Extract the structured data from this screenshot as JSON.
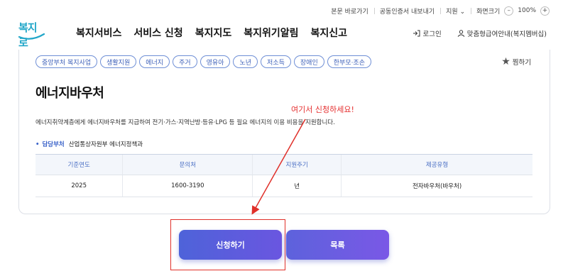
{
  "utility": {
    "skip_link": "본문 바로가기",
    "cert": "공동인증서 내보내기",
    "region": "지원",
    "text_size_label": "화면크기",
    "zoom_minus": "–",
    "zoom_level": "100%",
    "zoom_plus": "+"
  },
  "logo": {
    "text": "복지로"
  },
  "nav": {
    "items": [
      {
        "label": "복지서비스"
      },
      {
        "label": "서비스 신청"
      },
      {
        "label": "복지지도"
      },
      {
        "label": "복지위기알림"
      },
      {
        "label": "복지신고"
      }
    ]
  },
  "header_right": {
    "login": "로그인",
    "guide": "맞춤형급여안내(복지멤버십)"
  },
  "tags": [
    "중앙부처 복지사업",
    "생활지원",
    "에너지",
    "주거",
    "영유아",
    "노년",
    "저소득",
    "장애인",
    "한부모·조손"
  ],
  "favorite": {
    "label": "찜하기"
  },
  "detail": {
    "title": "에너지바우처",
    "description": "에너지취약계층에게 에너지바우처를 지급하여 전기·가스·지역난방·등유·LPG 등 필요 에너지의 이용 비용을 지원합니다.",
    "dept_label": "담당부처",
    "dept_value": "산업통상자원부 에너지정책과"
  },
  "table": {
    "headers": [
      "기준연도",
      "문의처",
      "지원주기",
      "제공유형"
    ],
    "rows": [
      [
        "2025",
        "1600-3190",
        "년",
        "전자바우처(바우처)"
      ]
    ]
  },
  "annotation": {
    "text": "여기서 신청하세요!"
  },
  "buttons": {
    "apply": "신청하기",
    "list": "목록"
  }
}
